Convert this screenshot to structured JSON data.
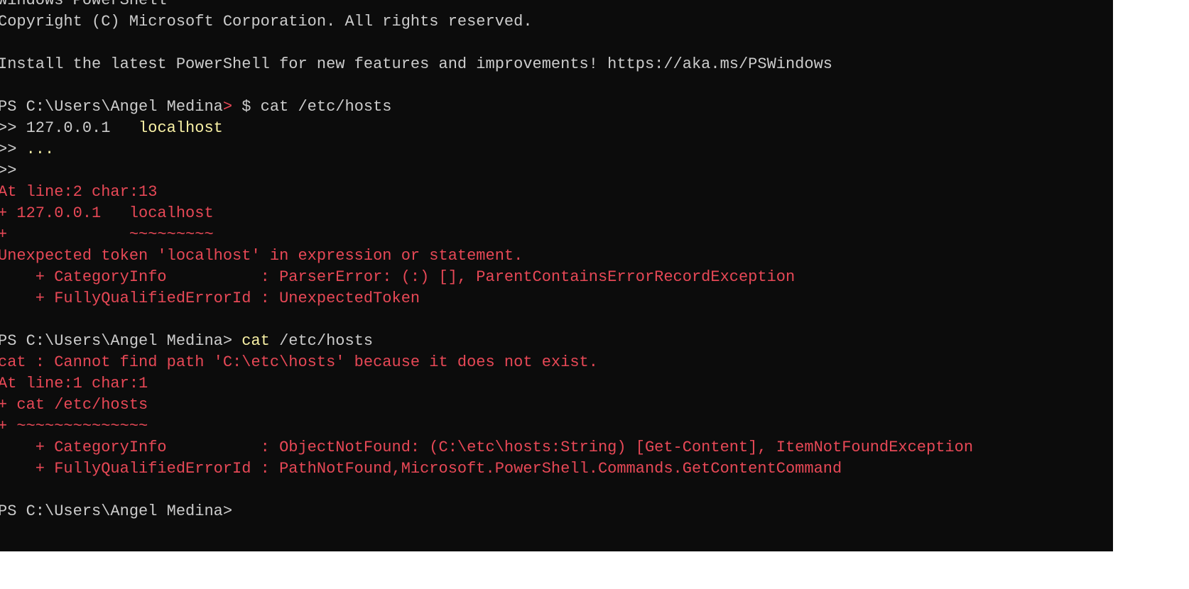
{
  "terminal": {
    "colors": {
      "background": "#0c0c0c",
      "default_text": "#cccccc",
      "error_text": "#e74856",
      "command_text": "#f9f1a5"
    },
    "lines": [
      [
        {
          "text": "Windows PowerShell",
          "color": "white"
        }
      ],
      [
        {
          "text": "Copyright (C) Microsoft Corporation. All rights reserved.",
          "color": "white"
        }
      ],
      [
        {
          "text": "",
          "color": "white"
        }
      ],
      [
        {
          "text": "Install the latest PowerShell for new features and improvements! https://aka.ms/PSWindows",
          "color": "white"
        }
      ],
      [
        {
          "text": "",
          "color": "white"
        }
      ],
      [
        {
          "text": "PS C:\\Users\\Angel Medina",
          "color": "white"
        },
        {
          "text": ">",
          "color": "red"
        },
        {
          "text": " $ cat /etc/hosts",
          "color": "white"
        }
      ],
      [
        {
          "text": ">> ",
          "color": "white"
        },
        {
          "text": "127.0.0.1",
          "color": "white"
        },
        {
          "text": "   localhost",
          "color": "yellow"
        }
      ],
      [
        {
          "text": ">> ",
          "color": "white"
        },
        {
          "text": "...",
          "color": "yellow"
        }
      ],
      [
        {
          "text": ">>",
          "color": "white"
        }
      ],
      [
        {
          "text": "At line:2 char:13",
          "color": "red"
        }
      ],
      [
        {
          "text": "+ 127.0.0.1   localhost",
          "color": "red"
        }
      ],
      [
        {
          "text": "+             ~~~~~~~~~",
          "color": "red"
        }
      ],
      [
        {
          "text": "Unexpected token 'localhost' in expression or statement.",
          "color": "red"
        }
      ],
      [
        {
          "text": "    + CategoryInfo          : ParserError: (:) [], ParentContainsErrorRecordException",
          "color": "red"
        }
      ],
      [
        {
          "text": "    + FullyQualifiedErrorId : UnexpectedToken",
          "color": "red"
        }
      ],
      [
        {
          "text": "",
          "color": "white"
        }
      ],
      [
        {
          "text": "PS C:\\Users\\Angel Medina> ",
          "color": "white"
        },
        {
          "text": "cat",
          "color": "yellow"
        },
        {
          "text": " /etc/hosts",
          "color": "white"
        }
      ],
      [
        {
          "text": "cat : Cannot find path 'C:\\etc\\hosts' because it does not exist.",
          "color": "red"
        }
      ],
      [
        {
          "text": "At line:1 char:1",
          "color": "red"
        }
      ],
      [
        {
          "text": "+ cat /etc/hosts",
          "color": "red"
        }
      ],
      [
        {
          "text": "+ ~~~~~~~~~~~~~~",
          "color": "red"
        }
      ],
      [
        {
          "text": "    + CategoryInfo          : ObjectNotFound: (C:\\etc\\hosts:String) [Get-Content], ItemNotFoundException",
          "color": "red"
        }
      ],
      [
        {
          "text": "    + FullyQualifiedErrorId : PathNotFound,Microsoft.PowerShell.Commands.GetContentCommand",
          "color": "red"
        }
      ],
      [
        {
          "text": "",
          "color": "white"
        }
      ],
      [
        {
          "text": "PS C:\\Users\\Angel Medina>",
          "color": "white"
        }
      ]
    ]
  }
}
